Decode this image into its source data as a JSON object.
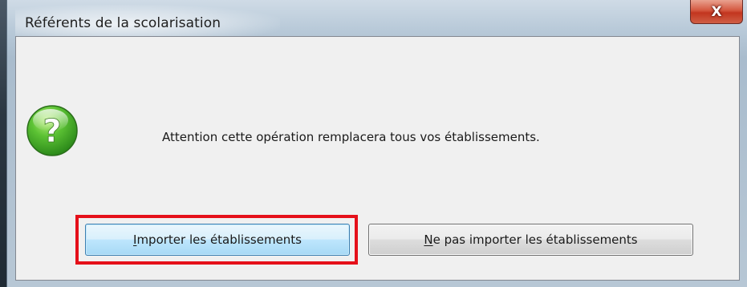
{
  "dialog": {
    "title": "Référents de la scolarisation",
    "close_label": "X",
    "icon": "question-icon",
    "message": "Attention cette opération remplacera tous vos établissements.",
    "buttons": {
      "import": {
        "mnemonic": "I",
        "rest": "mporter les établissements"
      },
      "no_import": {
        "mnemonic": "N",
        "rest": "e pas importer les établissements"
      }
    },
    "highlight_color": "#e5101a"
  }
}
